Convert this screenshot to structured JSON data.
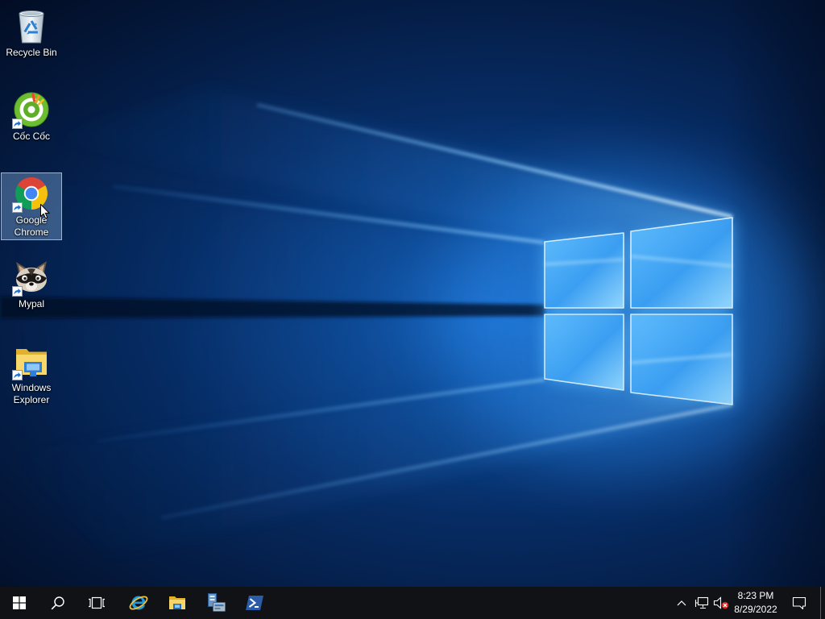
{
  "desktop": {
    "icons": [
      {
        "label": "Recycle Bin",
        "icon": "recycle-bin-icon",
        "shortcut": false,
        "selected": false
      },
      {
        "label": "Cốc Cốc",
        "icon": "coccoc-browser-icon",
        "shortcut": true,
        "selected": false
      },
      {
        "label": "Google Chrome",
        "icon": "chrome-icon",
        "shortcut": true,
        "selected": true
      },
      {
        "label": "Mypal",
        "icon": "mypal-browser-icon",
        "shortcut": true,
        "selected": false
      },
      {
        "label": "Windows Explorer",
        "icon": "windows-explorer-icon",
        "shortcut": true,
        "selected": false
      }
    ]
  },
  "taskbar": {
    "start_icon": "windows-start-icon",
    "search_icon": "search-icon",
    "task_view_icon": "task-view-icon",
    "pinned_apps": [
      {
        "icon": "internet-explorer-icon"
      },
      {
        "icon": "file-explorer-icon"
      },
      {
        "icon": "server-manager-icon"
      },
      {
        "icon": "powershell-icon"
      }
    ],
    "tray": {
      "overflow_icon": "chevron-up-icon",
      "network_icon": "network-wired-icon",
      "volume_icon": "volume-error-icon",
      "time": "8:23 PM",
      "date": "8/29/2022",
      "action_center_icon": "action-center-icon"
    }
  },
  "colors": {
    "taskbar_bg": "#101216",
    "tray_text": "#ffffff",
    "desktop_label_text": "#ffffff",
    "selection_fill": "#7ea6d66e",
    "selection_border": "#b9d3f0bf",
    "volume_error": "#e0201b"
  }
}
